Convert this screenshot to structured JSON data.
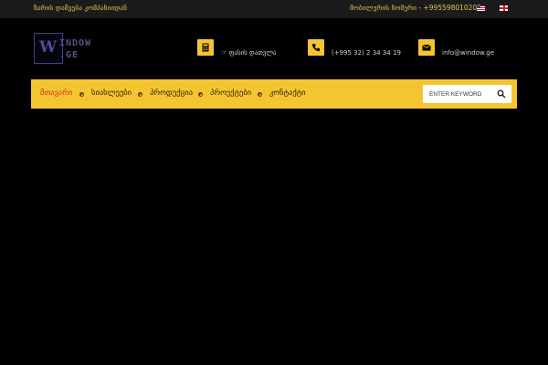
{
  "topbar": {
    "call_request": "ზარის დაშვება კომპანიიდან",
    "mobile_phone": "მობილურის ნომერი - +995598010202",
    "languages": [
      {
        "name": "english-flag"
      },
      {
        "name": "georgian-flag"
      }
    ]
  },
  "logo": {
    "line1": "INDOW",
    "line2": ".GE",
    "letter": "W"
  },
  "contacts": {
    "calculator_label": "ფასის დათვლა",
    "phone": "(+995 32) 2 34 34 19",
    "email": "info@window.ge"
  },
  "nav": {
    "items": [
      {
        "label": "მთავარი",
        "active": true
      },
      {
        "label": "სიახლეები",
        "active": false
      },
      {
        "label": "პროდუქცია",
        "active": false
      },
      {
        "label": "პროექტები",
        "active": false
      },
      {
        "label": "კონტაქტი",
        "active": false
      }
    ]
  },
  "search": {
    "placeholder": "ENTER KEYWORD"
  },
  "colors": {
    "accent": "#f5c531",
    "active_nav": "#c4381e",
    "topbar_text": "#e8c04a",
    "background": "#000000"
  }
}
